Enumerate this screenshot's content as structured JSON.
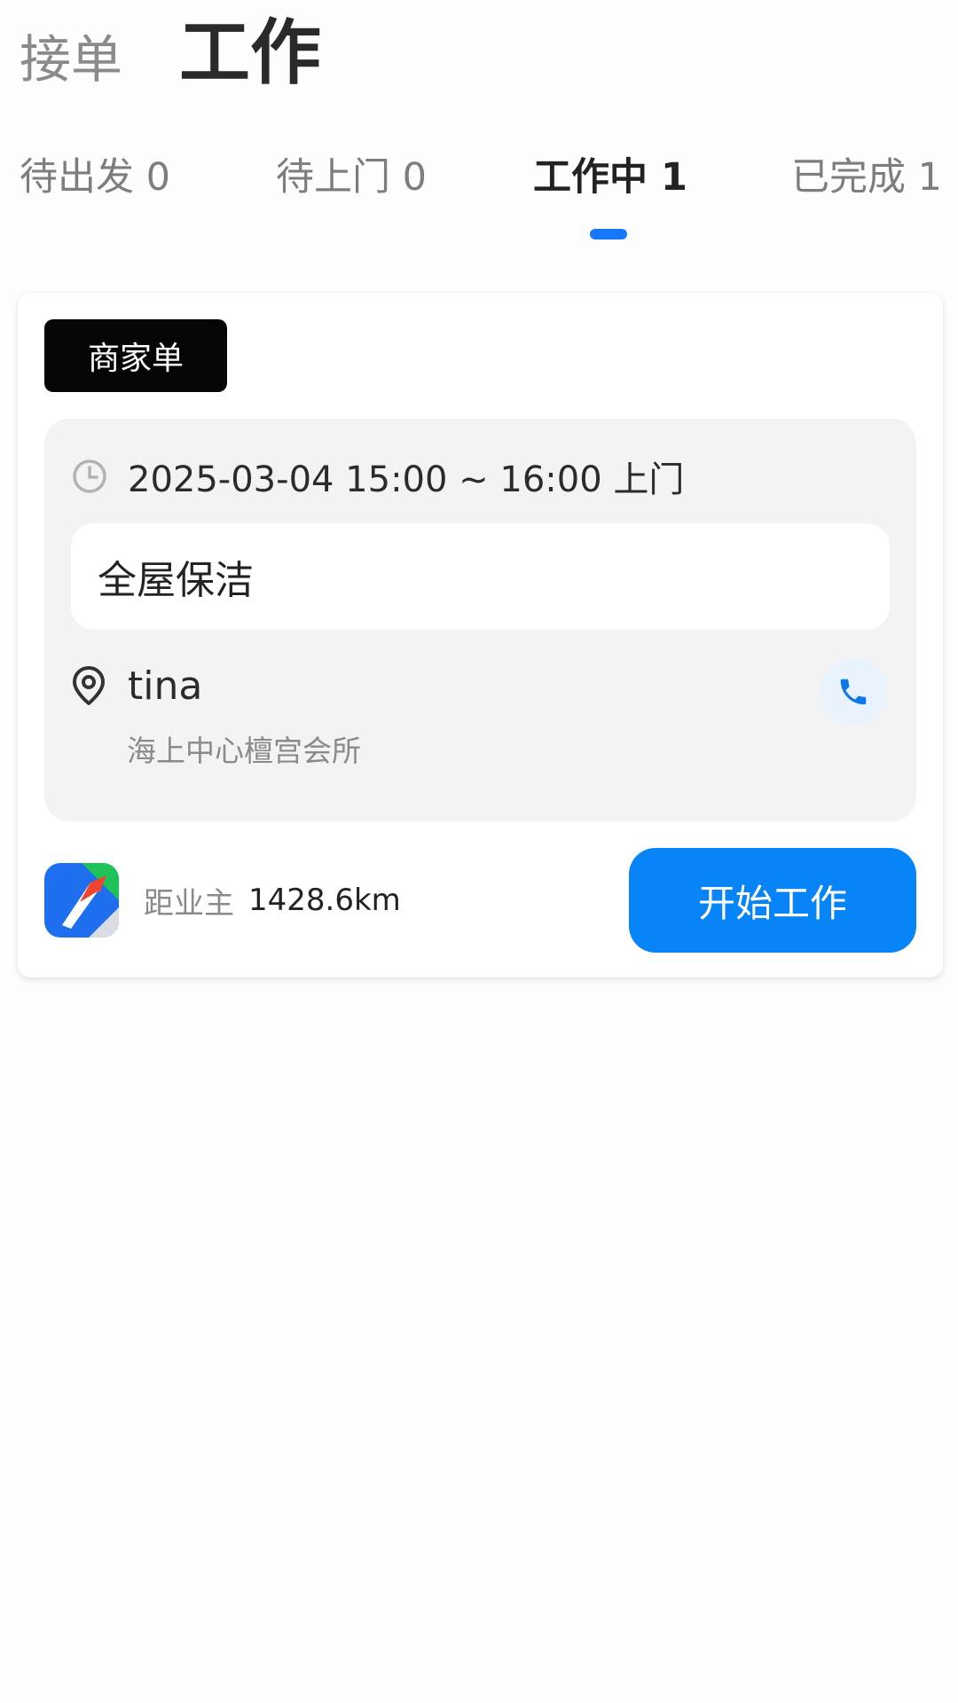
{
  "top_tabs": [
    {
      "label": "接单",
      "active": false
    },
    {
      "label": "工作",
      "active": true
    }
  ],
  "status_tabs": [
    {
      "label": "待出发 0",
      "active": false
    },
    {
      "label": "待上门 0",
      "active": false
    },
    {
      "label": "工作中 1",
      "active": true
    },
    {
      "label": "已完成 1",
      "active": false
    }
  ],
  "order": {
    "type_badge": "商家单",
    "time": "2025-03-04 15:00 ~ 16:00 上门",
    "service": "全屋保洁",
    "customer_name": "tina",
    "address": "海上中心檀宫会所",
    "distance_label": "距业主",
    "distance_value": "1428.6km",
    "action_label": "开始工作"
  },
  "icons": {
    "time": "clock-icon",
    "location": "location-pin-icon",
    "call": "phone-icon",
    "navigation_app": "navigation-app-icon"
  },
  "colors": {
    "accent": "#0784f7",
    "indicator": "#1677ff",
    "badge_bg": "#050505",
    "panel_bg": "#f3f3f4",
    "call_bg": "#e8f3fd"
  }
}
